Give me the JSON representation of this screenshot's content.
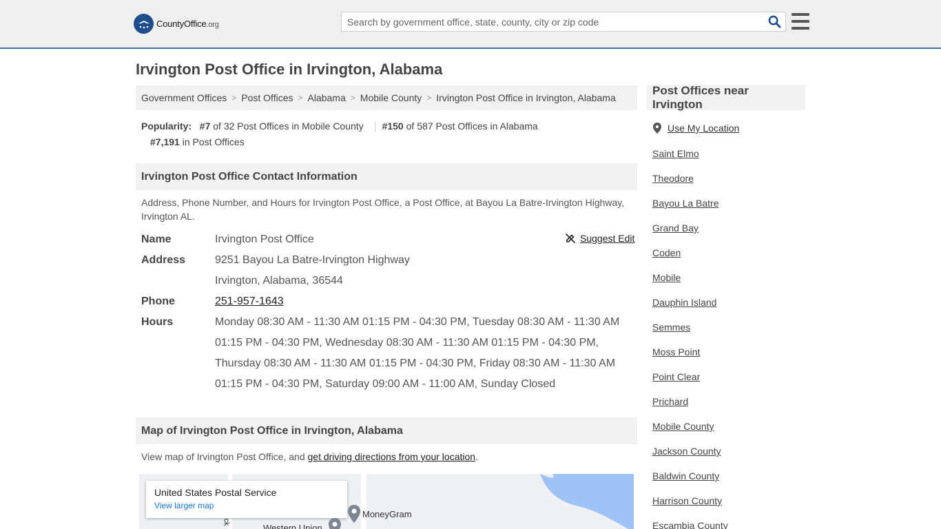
{
  "header": {
    "logo_main": "CountyOffice",
    "logo_suffix": ".org",
    "search_placeholder": "Search by government office, state, county, city or zip code"
  },
  "page_title": "Irvington Post Office in Irvington, Alabama",
  "breadcrumb": [
    "Government Offices",
    "Post Offices",
    "Alabama",
    "Mobile County",
    "Irvington Post Office in Irvington, Alabama"
  ],
  "popularity": {
    "label": "Popularity:",
    "rank1": "#7",
    "text1": "of 32 Post Offices in Mobile County",
    "rank2": "#150",
    "text2": "of 587 Post Offices in Alabama",
    "rank3": "#7,191",
    "text3": "in Post Offices"
  },
  "contact": {
    "heading": "Irvington Post Office Contact Information",
    "description": "Address, Phone Number, and Hours for Irvington Post Office, a Post Office, at Bayou La Batre-Irvington Highway, Irvington AL.",
    "suggest_edit": "Suggest Edit",
    "name_label": "Name",
    "name": "Irvington Post Office",
    "address_label": "Address",
    "address_line1": "9251 Bayou La Batre-Irvington Highway",
    "address_line2": "Irvington, Alabama, 36544",
    "phone_label": "Phone",
    "phone": "251-957-1643",
    "hours_label": "Hours",
    "hours": "Monday 08:30 AM - 11:30 AM 01:15 PM - 04:30 PM, Tuesday 08:30 AM - 11:30 AM 01:15 PM - 04:30 PM, Wednesday 08:30 AM - 11:30 AM 01:15 PM - 04:30 PM, Thursday 08:30 AM - 11:30 AM 01:15 PM - 04:30 PM, Friday 08:30 AM - 11:30 AM 01:15 PM - 04:30 PM, Saturday 09:00 AM - 11:00 AM, Sunday Closed"
  },
  "map_section": {
    "heading": "Map of Irvington Post Office in Irvington, Alabama",
    "desc_prefix": "View map of Irvington Post Office, and ",
    "desc_link": "get driving directions from your location",
    "desc_suffix": ".",
    "card_title": "United States Postal Service",
    "card_link": "View larger map",
    "label_moneygram": "MoneyGram",
    "label_western_union": "Western Union",
    "label_road": "ck"
  },
  "sidebar": {
    "heading": "Post Offices near Irvington",
    "use_location": "Use My Location",
    "items": [
      "Saint Elmo",
      "Theodore",
      "Bayou La Batre",
      "Grand Bay",
      "Coden",
      "Mobile",
      "Dauphin Island",
      "Semmes",
      "Moss Point",
      "Point Clear",
      "Prichard",
      "Mobile County",
      "Jackson County",
      "Baldwin County",
      "Harrison County",
      "Escambia County"
    ]
  },
  "colors": {
    "brand_blue": "#1e4d8c",
    "header_bg": "#efefef",
    "panel_bg": "#f1f1f1",
    "water": "#9fc2f7"
  }
}
